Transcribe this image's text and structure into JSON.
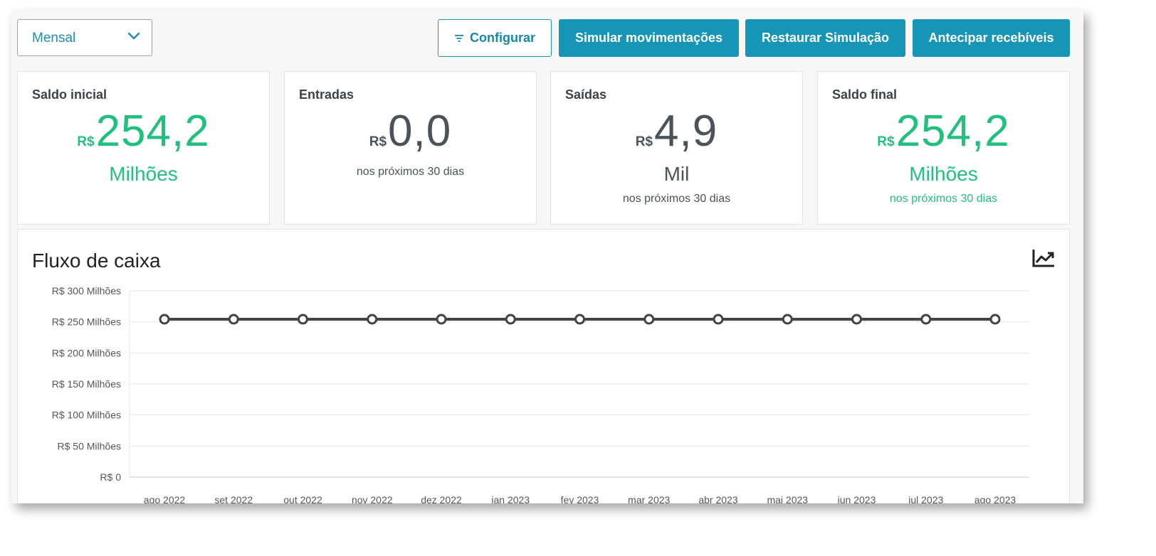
{
  "toolbar": {
    "period_select": "Mensal",
    "configure_label": "Configurar",
    "simulate_label": "Simular movimentações",
    "restore_label": "Restaurar Simulação",
    "advance_label": "Antecipar recebíveis"
  },
  "cards": {
    "saldo_inicial": {
      "title": "Saldo inicial",
      "currency": "R$",
      "value": "254,2",
      "unit": "Milhões"
    },
    "entradas": {
      "title": "Entradas",
      "currency": "R$",
      "value": "0,0",
      "note": "nos próximos 30 dias"
    },
    "saidas": {
      "title": "Saídas",
      "currency": "R$",
      "value": "4,9",
      "unit": "Mil",
      "note": "nos próximos 30 dias"
    },
    "saldo_final": {
      "title": "Saldo final",
      "currency": "R$",
      "value": "254,2",
      "unit": "Milhões",
      "note": "nos próximos 30 dias"
    }
  },
  "chart_section": {
    "title": "Fluxo de caixa",
    "icon": "line-chart-icon"
  },
  "colors": {
    "accent": "#1795b7",
    "positive": "#22c07e",
    "line": "#444444"
  },
  "chart_data": {
    "type": "line",
    "categories": [
      "ago 2022",
      "set 2022",
      "out 2022",
      "nov 2022",
      "dez 2022",
      "jan 2023",
      "fev 2023",
      "mar 2023",
      "abr 2023",
      "mai 2023",
      "jun 2023",
      "jul 2023",
      "ago 2023"
    ],
    "series": [
      {
        "values": [
          254.2,
          254.2,
          254.2,
          254.2,
          254.2,
          254.2,
          254.2,
          254.2,
          254.2,
          254.2,
          254.2,
          254.2,
          254.2
        ]
      }
    ],
    "yticks": [
      0,
      50,
      100,
      150,
      200,
      250,
      300
    ],
    "ytick_labels": [
      "R$ 0",
      "R$ 50 Milhões",
      "R$ 100 Milhões",
      "R$ 150 Milhões",
      "R$ 200 Milhões",
      "R$ 250 Milhões",
      "R$ 300 Milhões"
    ],
    "ylim": [
      0,
      300
    ],
    "grid": true,
    "title": "",
    "xlabel": "",
    "ylabel": ""
  }
}
